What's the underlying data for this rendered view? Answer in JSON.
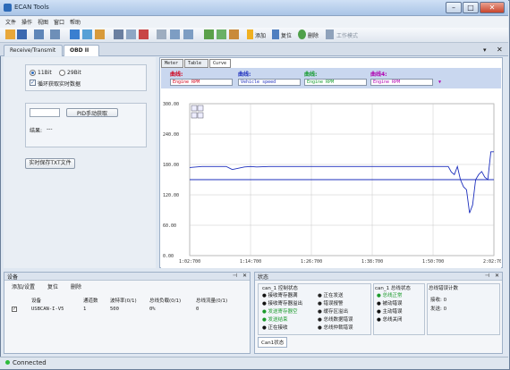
{
  "app": {
    "title": "ECAN Tools"
  },
  "menu": [
    "文件",
    "操作",
    "视图",
    "窗口",
    "帮助"
  ],
  "toolbar": {
    "add": "添加",
    "reset": "复位",
    "delete": "删除",
    "workmode": "工作模式"
  },
  "tabs": {
    "receive": "Receive/Transmit",
    "obd": "OBD II"
  },
  "left": {
    "r11": "11Bit",
    "r29": "29Bit",
    "loop": "循环获取实时数据",
    "pid_btn": "PID手动获取",
    "result_label": "结果:",
    "result_value": "---",
    "save_btn": "实时保存TXT文件"
  },
  "right": {
    "subtabs": [
      "Meter",
      "Table",
      "Curve"
    ],
    "curves": [
      {
        "label": "曲线:",
        "value": "Engine RPM",
        "color": "#d0001a"
      },
      {
        "label": "曲线:",
        "value": "Vehicle speed",
        "color": "#1d2fbd"
      },
      {
        "label": "曲线:",
        "value": "Engine RPM",
        "color": "#139a2c"
      },
      {
        "label": "曲线4:",
        "value": "Engine RPM",
        "color": "#b000b0"
      }
    ]
  },
  "chart_data": {
    "type": "line",
    "yticks": [
      "300.00",
      "240.00",
      "180.00",
      "120.00",
      "60.00",
      "0.00"
    ],
    "xticks": [
      "1:02:700",
      "1:14:700",
      "1:26:700",
      "1:38:700",
      "1:50:700",
      "2:02:700"
    ],
    "ylim": [
      0,
      300
    ],
    "series": [
      {
        "color": "#1d2fbd",
        "x": [
          0,
          4,
          8,
          10,
          12,
          14,
          18,
          20,
          22,
          26,
          30,
          35,
          40,
          45,
          50,
          55,
          60,
          65,
          70,
          75,
          80,
          85,
          86,
          87,
          88,
          89,
          90,
          91,
          92,
          93,
          94,
          95,
          96,
          97,
          98,
          99,
          100
        ],
        "y": [
          174,
          176,
          176,
          176,
          176,
          170,
          175,
          176,
          175,
          176,
          176,
          176,
          176,
          176,
          176,
          176,
          176,
          176,
          176,
          176,
          176,
          176,
          165,
          160,
          176,
          150,
          136,
          130,
          84,
          100,
          150,
          160,
          166,
          155,
          150,
          205,
          205
        ]
      },
      {
        "color": "#1d2fbd",
        "x": [
          0,
          100
        ],
        "y": [
          150,
          150
        ]
      }
    ]
  },
  "device_panel": {
    "title": "设备",
    "add": "添加/设置",
    "reset": "复位",
    "delete": "删除",
    "cols": [
      "设备",
      "通道数",
      "波特率(0/1)",
      "总线负载(0/1)",
      "总线流量(0/1)"
    ],
    "row": [
      "USBCAN-I-V5",
      "1",
      "500",
      "0%",
      "0"
    ]
  },
  "status_panel": {
    "title": "状态",
    "group1": "can_1 控制状态",
    "group2": "can_1 总线状态",
    "group3": "总线错误计数",
    "items1": [
      "接收寄存器满",
      "接收寄存器溢出",
      "发送寄存器空",
      "发送结束",
      "正在接收"
    ],
    "items1b": [
      "正在发送",
      "错误报警",
      "缓存区溢出",
      "总线数据错误",
      "总线仲裁错误"
    ],
    "items2": [
      "总线正常",
      "被动错误",
      "主动错误",
      "总线关闭"
    ],
    "rx": "接收: 0",
    "tx": "发送: 0",
    "tab": "Can1状态"
  },
  "status_bar": {
    "text": "Connected"
  }
}
